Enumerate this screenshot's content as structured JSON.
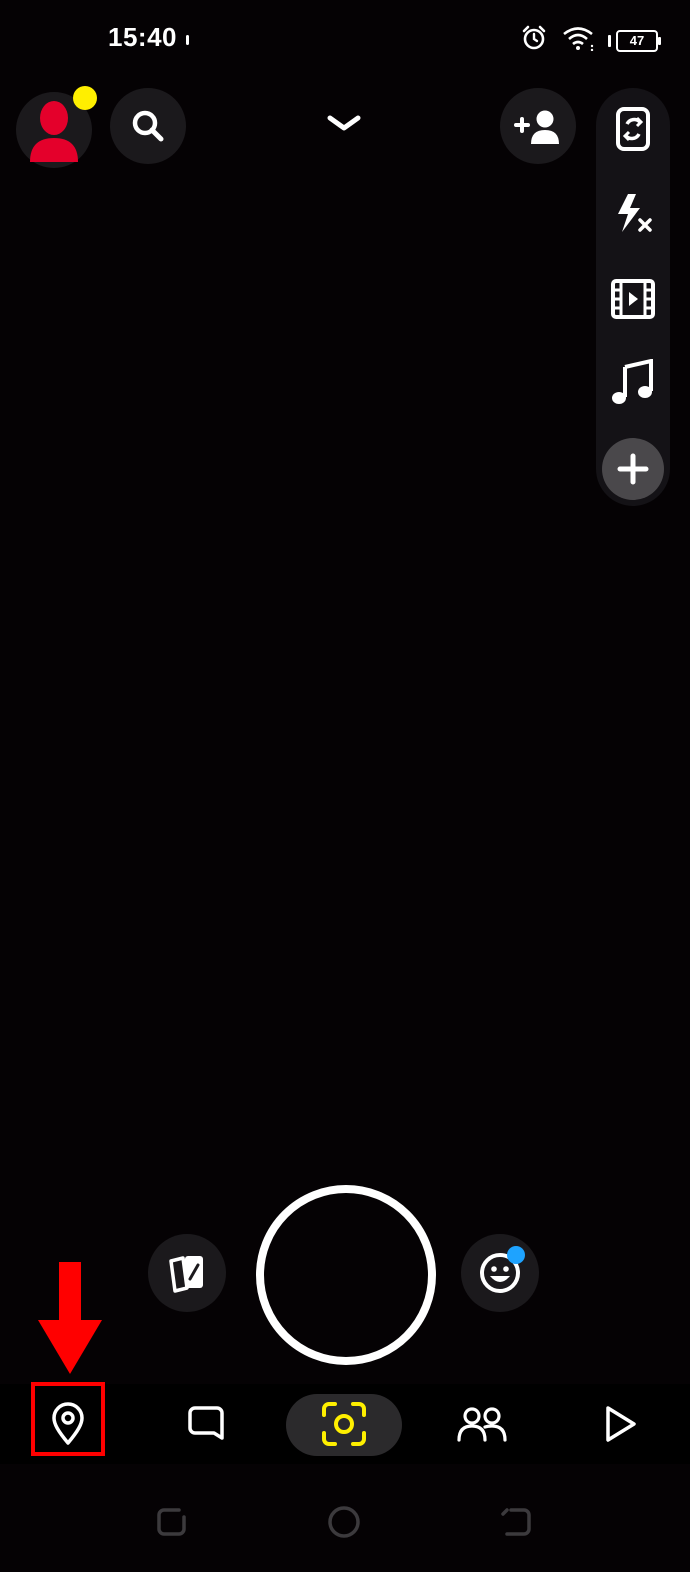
{
  "status_bar": {
    "time": "15:40",
    "battery": "47"
  },
  "colors": {
    "accent_yellow": "#ffef00",
    "avatar_red": "#e4002b",
    "badge_blue": "#1ea3ff",
    "highlight_red": "#ff0000",
    "background": "#050204"
  },
  "top_bar": {
    "profile": "profile-avatar-icon",
    "search": "search-icon",
    "expand": "chevron-down-icon",
    "add_friend": "add-friend-icon"
  },
  "side_tools": [
    "flip-camera-icon",
    "flash-off-icon",
    "video-timeline-icon",
    "music-note-icon",
    "plus-icon"
  ],
  "capture_row": [
    "memories-icon",
    "shutter-button",
    "lens-smiley-icon"
  ],
  "bottom_nav": [
    "map-pin-icon",
    "chat-icon",
    "camera-icon",
    "friends-icon",
    "play-icon"
  ],
  "system_nav": [
    "recents-icon",
    "home-icon",
    "back-icon"
  ]
}
